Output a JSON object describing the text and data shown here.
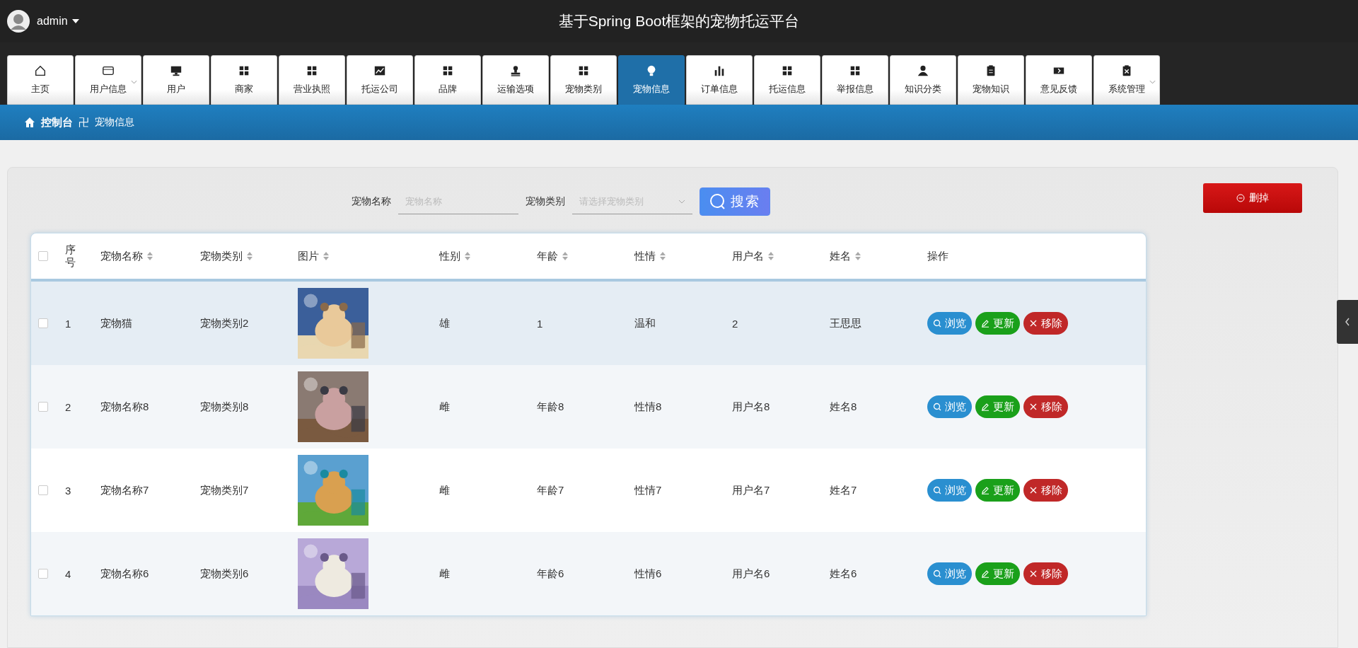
{
  "header": {
    "user": "admin",
    "title": "基于Spring Boot框架的宠物托运平台"
  },
  "tabs": [
    {
      "label": "主页",
      "selected": false,
      "dropdown": false
    },
    {
      "label": "用户信息",
      "selected": false,
      "dropdown": true
    },
    {
      "label": "用户",
      "selected": false,
      "dropdown": false
    },
    {
      "label": "商家",
      "selected": false,
      "dropdown": false
    },
    {
      "label": "营业执照",
      "selected": false,
      "dropdown": false
    },
    {
      "label": "托运公司",
      "selected": false,
      "dropdown": false
    },
    {
      "label": "品牌",
      "selected": false,
      "dropdown": false
    },
    {
      "label": "运输选项",
      "selected": false,
      "dropdown": false
    },
    {
      "label": "宠物类别",
      "selected": false,
      "dropdown": false
    },
    {
      "label": "宠物信息",
      "selected": true,
      "dropdown": false
    },
    {
      "label": "订单信息",
      "selected": false,
      "dropdown": false
    },
    {
      "label": "托运信息",
      "selected": false,
      "dropdown": false
    },
    {
      "label": "举报信息",
      "selected": false,
      "dropdown": false
    },
    {
      "label": "知识分类",
      "selected": false,
      "dropdown": false
    },
    {
      "label": "宠物知识",
      "selected": false,
      "dropdown": false
    },
    {
      "label": "意见反馈",
      "selected": false,
      "dropdown": false
    },
    {
      "label": "系统管理",
      "selected": false,
      "dropdown": true
    }
  ],
  "breadcrumb": {
    "home": "控制台",
    "separator": "卍",
    "current": "宠物信息"
  },
  "search": {
    "name_label": "宠物名称",
    "name_placeholder": "宠物名称",
    "type_label": "宠物类别",
    "type_placeholder": "请选择宠物类别",
    "search_button": "搜索",
    "delete_button": "删掉"
  },
  "table": {
    "columns": [
      {
        "label": "序号",
        "sortable": false
      },
      {
        "label": "宠物名称",
        "sortable": true
      },
      {
        "label": "宠物类别",
        "sortable": true
      },
      {
        "label": "图片",
        "sortable": true
      },
      {
        "label": "性别",
        "sortable": true
      },
      {
        "label": "年龄",
        "sortable": true
      },
      {
        "label": "性情",
        "sortable": true
      },
      {
        "label": "用户名",
        "sortable": true
      },
      {
        "label": "姓名",
        "sortable": true
      },
      {
        "label": "操作",
        "sortable": false
      }
    ],
    "header_checked": false,
    "rows": [
      {
        "checked": false,
        "hovered": true,
        "no": "1",
        "pet_name": "宠物猫",
        "pet_type": "宠物类别2",
        "image": {
          "kind": "picture"
        },
        "gender": "雄",
        "age": "1",
        "temper": "温和",
        "username": "2",
        "real_name": "王思思",
        "actions": [
          {
            "kind": "view",
            "label": "浏览"
          },
          {
            "kind": "edit",
            "label": "更新"
          },
          {
            "kind": "remove",
            "label": "移除"
          }
        ]
      },
      {
        "checked": false,
        "hovered": false,
        "no": "2",
        "pet_name": "宠物名称8",
        "pet_type": "宠物类别8",
        "image": {
          "kind": "picture"
        },
        "gender": "雌",
        "age": "年龄8",
        "temper": "性情8",
        "username": "用户名8",
        "real_name": "姓名8",
        "actions": [
          {
            "kind": "view",
            "label": "浏览"
          },
          {
            "kind": "edit",
            "label": "更新"
          },
          {
            "kind": "remove",
            "label": "移除"
          }
        ]
      },
      {
        "checked": false,
        "hovered": false,
        "no": "3",
        "pet_name": "宠物名称7",
        "pet_type": "宠物类别7",
        "image": {
          "kind": "picture"
        },
        "gender": "雌",
        "age": "年龄7",
        "temper": "性情7",
        "username": "用户名7",
        "real_name": "姓名7",
        "actions": [
          {
            "kind": "view",
            "label": "浏览"
          },
          {
            "kind": "edit",
            "label": "更新"
          },
          {
            "kind": "remove",
            "label": "移除"
          }
        ]
      },
      {
        "checked": false,
        "hovered": false,
        "no": "4",
        "pet_name": "宠物名称6",
        "pet_type": "宠物类别6",
        "image": {
          "kind": "picture"
        },
        "gender": "雌",
        "age": "年龄6",
        "temper": "性情6",
        "username": "用户名6",
        "real_name": "姓名6",
        "actions": [
          {
            "kind": "view",
            "label": "浏览"
          },
          {
            "kind": "edit",
            "label": "更新"
          },
          {
            "kind": "remove",
            "label": "移除"
          }
        ]
      }
    ]
  }
}
